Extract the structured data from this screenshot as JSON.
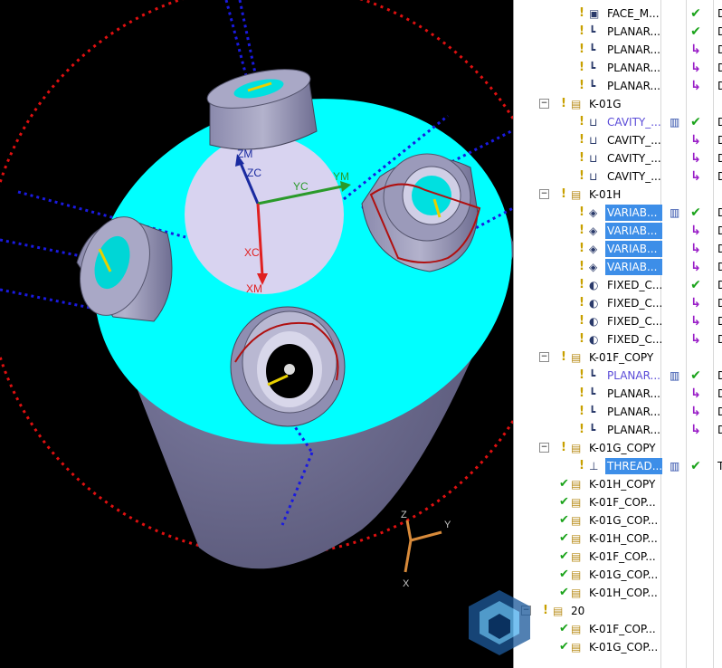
{
  "viewport": {
    "csys_labels": {
      "zm": "ZM",
      "zc": "ZC",
      "yc": "YC",
      "ym": "YM",
      "xc": "XC",
      "xm": "XM"
    },
    "triad_labels": {
      "z": "Z",
      "y": "Y",
      "x": "X"
    },
    "colors": {
      "body": "#6b6a8f",
      "top_face": "#00ffff",
      "background": "#000000",
      "axis_blue": "#1515e0",
      "circle_red": "#e01010"
    }
  },
  "navigator": {
    "rows": [
      {
        "indent": 2,
        "status": "bulb",
        "icon": "face-milling-icon",
        "name": "FACE_M...",
        "name_color": "black",
        "sel": false,
        "col3": "check",
        "col4": "D"
      },
      {
        "indent": 2,
        "status": "bulb",
        "icon": "planar-mill-icon",
        "name": "PLANAR...",
        "name_color": "black",
        "sel": false,
        "col3": "check",
        "col4": "D"
      },
      {
        "indent": 2,
        "status": "bulb",
        "icon": "planar-mill-icon",
        "name": "PLANAR...",
        "name_color": "black",
        "sel": false,
        "col3": "arrow",
        "col4": "D"
      },
      {
        "indent": 2,
        "status": "bulb",
        "icon": "planar-mill-icon",
        "name": "PLANAR...",
        "name_color": "black",
        "sel": false,
        "col3": "arrow",
        "col4": "D"
      },
      {
        "indent": 2,
        "status": "bulb",
        "icon": "planar-mill-icon",
        "name": "PLANAR...",
        "name_color": "black",
        "sel": false,
        "col3": "arrow",
        "col4": "D"
      },
      {
        "indent": 1,
        "exp": "−",
        "status": "bulb",
        "icon": "program-group-icon",
        "name": "K-01G",
        "name_color": "black",
        "sel": false,
        "col3": "",
        "col4": ""
      },
      {
        "indent": 2,
        "status": "bulb",
        "icon": "cavity-mill-icon",
        "name": "CAVITY_...",
        "name_color": "blue",
        "sel": false,
        "col2": "tool-path-icon",
        "col3": "check",
        "col4": "D"
      },
      {
        "indent": 2,
        "status": "bulb",
        "icon": "cavity-mill-icon",
        "name": "CAVITY_...",
        "name_color": "black",
        "sel": false,
        "col3": "arrow",
        "col4": "D"
      },
      {
        "indent": 2,
        "status": "bulb",
        "icon": "cavity-mill-icon",
        "name": "CAVITY_...",
        "name_color": "black",
        "sel": false,
        "col3": "arrow",
        "col4": "D"
      },
      {
        "indent": 2,
        "status": "bulb",
        "icon": "cavity-mill-icon",
        "name": "CAVITY_...",
        "name_color": "black",
        "sel": false,
        "col3": "arrow",
        "col4": "D"
      },
      {
        "indent": 1,
        "exp": "−",
        "status": "bulb",
        "icon": "program-group-icon",
        "name": "K-01H",
        "name_color": "black",
        "sel": false,
        "col3": "",
        "col4": ""
      },
      {
        "indent": 2,
        "status": "bulb",
        "icon": "variable-contour-icon",
        "name": "VARIAB...",
        "name_color": "black",
        "sel": true,
        "col2": "tool-path-icon",
        "col3": "check",
        "col4": "D"
      },
      {
        "indent": 2,
        "status": "bulb",
        "icon": "variable-contour-icon",
        "name": "VARIAB...",
        "name_color": "black",
        "sel": true,
        "col3": "arrow",
        "col4": "D"
      },
      {
        "indent": 2,
        "status": "bulb",
        "icon": "variable-contour-icon",
        "name": "VARIAB...",
        "name_color": "black",
        "sel": true,
        "col3": "arrow",
        "col4": "D"
      },
      {
        "indent": 2,
        "status": "bulb",
        "icon": "variable-contour-icon",
        "name": "VARIAB...",
        "name_color": "black",
        "sel": true,
        "col3": "arrow",
        "col4": "D"
      },
      {
        "indent": 2,
        "status": "bulb",
        "icon": "fixed-contour-icon",
        "name": "FIXED_C...",
        "name_color": "black",
        "sel": false,
        "col3": "check",
        "col4": "D"
      },
      {
        "indent": 2,
        "status": "bulb",
        "icon": "fixed-contour-icon",
        "name": "FIXED_C...",
        "name_color": "black",
        "sel": false,
        "col3": "arrow",
        "col4": "D"
      },
      {
        "indent": 2,
        "status": "bulb",
        "icon": "fixed-contour-icon",
        "name": "FIXED_C...",
        "name_color": "black",
        "sel": false,
        "col3": "arrow",
        "col4": "D"
      },
      {
        "indent": 2,
        "status": "bulb",
        "icon": "fixed-contour-icon",
        "name": "FIXED_C...",
        "name_color": "black",
        "sel": false,
        "col3": "arrow",
        "col4": "D"
      },
      {
        "indent": 1,
        "exp": "−",
        "status": "bulb",
        "icon": "program-group-icon",
        "name": "K-01F_COPY",
        "name_color": "black",
        "sel": false,
        "col3": "",
        "col4": ""
      },
      {
        "indent": 2,
        "status": "bulb",
        "icon": "planar-mill-icon",
        "name": "PLANAR...",
        "name_color": "blue",
        "sel": false,
        "col2": "tool-path-icon",
        "col3": "check",
        "col4": "D"
      },
      {
        "indent": 2,
        "status": "bulb",
        "icon": "planar-mill-icon",
        "name": "PLANAR...",
        "name_color": "black",
        "sel": false,
        "col3": "arrow",
        "col4": "D"
      },
      {
        "indent": 2,
        "status": "bulb",
        "icon": "planar-mill-icon",
        "name": "PLANAR...",
        "name_color": "black",
        "sel": false,
        "col3": "arrow",
        "col4": "D"
      },
      {
        "indent": 2,
        "status": "bulb",
        "icon": "planar-mill-icon",
        "name": "PLANAR...",
        "name_color": "black",
        "sel": false,
        "col3": "arrow",
        "col4": "D"
      },
      {
        "indent": 1,
        "exp": "−",
        "status": "bulb",
        "icon": "program-group-icon",
        "name": "K-01G_COPY",
        "name_color": "black",
        "sel": false,
        "col3": "",
        "col4": ""
      },
      {
        "indent": 2,
        "status": "bulb",
        "icon": "thread-mill-icon",
        "name": "THREAD...",
        "name_color": "black",
        "sel": true,
        "col2": "tool-path-icon",
        "col3": "check",
        "col4": "T"
      },
      {
        "indent": 1,
        "status": "check",
        "icon": "program-group-icon",
        "name": "K-01H_COPY",
        "name_color": "black",
        "sel": false,
        "col3": "",
        "col4": ""
      },
      {
        "indent": 1,
        "status": "check",
        "icon": "program-group-icon",
        "name": "K-01F_COP...",
        "name_color": "black",
        "sel": false,
        "col3": "",
        "col4": ""
      },
      {
        "indent": 1,
        "status": "check",
        "icon": "program-group-icon",
        "name": "K-01G_COP...",
        "name_color": "black",
        "sel": false,
        "col3": "",
        "col4": ""
      },
      {
        "indent": 1,
        "status": "check",
        "icon": "program-group-icon",
        "name": "K-01H_COP...",
        "name_color": "black",
        "sel": false,
        "col3": "",
        "col4": ""
      },
      {
        "indent": 1,
        "status": "check",
        "icon": "program-group-icon",
        "name": "K-01F_COP...",
        "name_color": "black",
        "sel": false,
        "col3": "",
        "col4": ""
      },
      {
        "indent": 1,
        "status": "check",
        "icon": "program-group-icon",
        "name": "K-01G_COP...",
        "name_color": "black",
        "sel": false,
        "col3": "",
        "col4": ""
      },
      {
        "indent": 1,
        "status": "check",
        "icon": "program-group-icon",
        "name": "K-01H_COP...",
        "name_color": "black",
        "sel": false,
        "col3": "",
        "col4": ""
      },
      {
        "indent": 0,
        "exp": "−",
        "status": "bulb",
        "icon": "program-group-icon",
        "name": "20",
        "name_color": "black",
        "sel": false,
        "col3": "",
        "col4": ""
      },
      {
        "indent": 1,
        "status": "check",
        "icon": "program-group-icon",
        "name": "K-01F_COP...",
        "name_color": "black",
        "sel": false,
        "col3": "",
        "col4": ""
      },
      {
        "indent": 1,
        "status": "check",
        "icon": "program-group-icon",
        "name": "K-01G_COP...",
        "name_color": "black",
        "sel": false,
        "col3": "",
        "col4": ""
      }
    ]
  }
}
